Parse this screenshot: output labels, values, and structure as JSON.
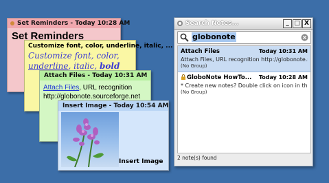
{
  "notes": {
    "reminders": {
      "header": "Set Reminders - Today 10:28 AM",
      "body": "Set Reminders"
    },
    "font": {
      "header": "Customize font, color, underline, italic, ...",
      "line1": "Customize font, color,",
      "underline": "underline",
      "italic": "italic,",
      "bold": "bold"
    },
    "attach": {
      "header": "Attach Files - Today 10:31 AM",
      "link": "Attach Files",
      "line1_rest": ", URL recognition",
      "line2": "http://globonote.sourceforge.net"
    },
    "image": {
      "header": "Insert Image - Today 10:54 AM",
      "caption": "Insert Image"
    }
  },
  "search_window": {
    "title": "Search Notes...",
    "buttons": [
      "_",
      "□",
      "X"
    ],
    "query": "globonote",
    "results": [
      {
        "title": "Attach Files",
        "time": "Today 10:31 AM",
        "preview": "Attach Files, URL recognition http://globonote.so...",
        "group": "(No Group)",
        "selected": true
      },
      {
        "title": "GloboNote HowTo...",
        "time": "Today 10:28 AM",
        "preview": "* Create new notes? Double click on  icon in the...",
        "group": "(No Group)",
        "selected": false
      }
    ],
    "status": "2 note(s) found"
  },
  "colors": {
    "desktop": "#3c6ea8",
    "pink": "#f4c7cb",
    "yellow": "#faf7a4",
    "green": "#d4f7c4",
    "blue": "#d4e6fb",
    "selection": "#c9dcf3"
  }
}
